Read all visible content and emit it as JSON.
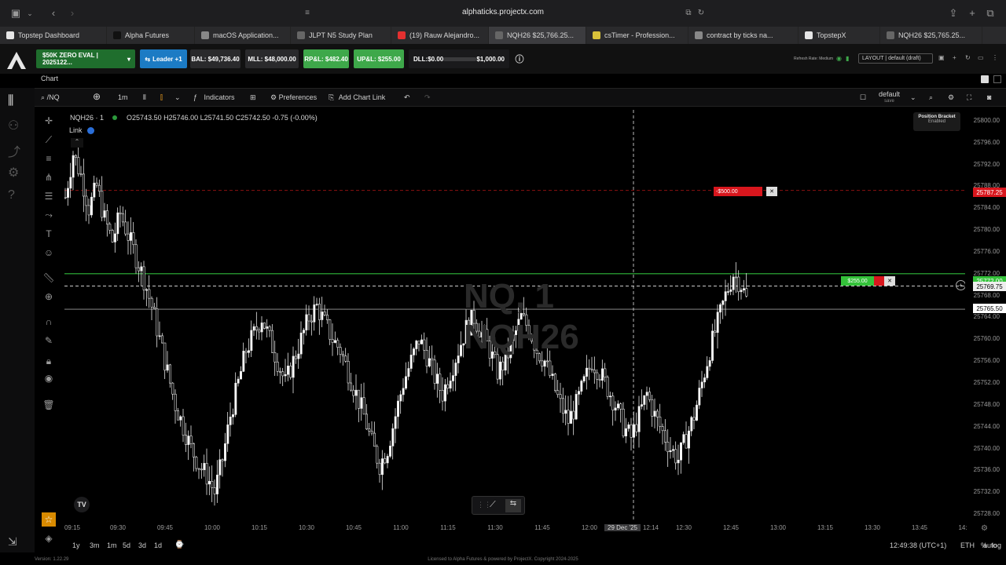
{
  "browser": {
    "url": "alphaticks.projectx.com",
    "tabs": [
      {
        "label": "Topstep Dashboard",
        "color": "#e6e6e6"
      },
      {
        "label": "Alpha Futures",
        "color": "#111111"
      },
      {
        "label": "macOS Application...",
        "color": "#888888"
      },
      {
        "label": "JLPT N5 Study Plan",
        "color": "#666666"
      },
      {
        "label": "(19) Rauw Alejandro...",
        "color": "#e33030"
      },
      {
        "label": "NQH26 $25,766.25...",
        "color": "#666666"
      },
      {
        "label": "csTimer - Profession...",
        "color": "#d9c23a"
      },
      {
        "label": "contract by ticks na...",
        "color": "#888888"
      },
      {
        "label": "TopstepX",
        "color": "#e6e6e6"
      },
      {
        "label": "NQH26 $25,765.25...",
        "color": "#666666"
      }
    ]
  },
  "account": {
    "account_label": "$50K ZERO EVAL | 2025122...",
    "leader_label": "Leader +1",
    "bal": "BAL: $49,736.40",
    "mll": "MLL: $48,000.00",
    "rpl": "RP&L: $482.40",
    "upl": "UP&L: $255.00",
    "dll": "DLL:$0.00",
    "dll_limit": "$1,000.00",
    "dll_progress": 0,
    "refresh": "Refresh Rate: Medium",
    "layout": "LAYOUT | default (draft)"
  },
  "chart_tab": "Chart",
  "toolbar": {
    "symbol": "/NQ",
    "interval": "1m",
    "indicators": "Indicators",
    "preferences": "Preferences",
    "add_chart_link": "Add Chart Link",
    "template": "default",
    "template_sub": "save"
  },
  "legend": {
    "title": "NQH26 · 1",
    "ohlc": "O25743.50 H25746.00 L25741.50 C25742.50 -0.75 (-0.00%)",
    "link": "Link"
  },
  "watermark": {
    "line1": "NQ, 1",
    "line2": "NQH26"
  },
  "position_bracket": {
    "title": "Position Bracket",
    "status": "Enabled"
  },
  "orders": {
    "stop_label": "-$500.00",
    "stop_price": "25787.25",
    "position_label": "$255.00",
    "position_price": "25769.75",
    "last_price": "25765.50",
    "green_line_price": "25772.00"
  },
  "chart_data": {
    "type": "candlestick",
    "symbol": "NQH26",
    "interval": "1",
    "y_ticks": [
      "25800.00",
      "25796.00",
      "25792.00",
      "25788.00",
      "25784.00",
      "25780.00",
      "25776.00",
      "25772.00",
      "25768.00",
      "25764.00",
      "25760.00",
      "25756.00",
      "25752.00",
      "25748.00",
      "25744.00",
      "25740.00",
      "25736.00",
      "25732.00",
      "25728.00"
    ],
    "x_ticks": [
      "09:15",
      "09:30",
      "09:45",
      "10:00",
      "10:15",
      "10:30",
      "10:45",
      "11:00",
      "11:15",
      "11:30",
      "11:45",
      "12:00",
      "29 Dec '25",
      "12:14",
      "12:30",
      "12:45",
      "13:00",
      "13:15",
      "13:30",
      "13:45",
      "14:"
    ],
    "ylim": [
      25727,
      25802
    ],
    "series": [
      {
        "values": [
          25786,
          25794,
          25790,
          25784,
          25788,
          25782,
          25778,
          25783,
          25779,
          25775,
          25771,
          25766,
          25760,
          25754,
          25748,
          25744,
          25740,
          25737,
          25735,
          25732,
          25738,
          25746,
          25752,
          25758,
          25761,
          25764,
          25760,
          25756,
          25752,
          25756,
          25760,
          25764,
          25766,
          25763,
          25760,
          25758,
          25754,
          25750,
          25746,
          25741,
          25737,
          25740,
          25746,
          25752,
          25756,
          25760,
          25757,
          25753,
          25750,
          25754,
          25758,
          25762,
          25764,
          25761,
          25758,
          25754,
          25756,
          25760,
          25764,
          25762,
          25758,
          25756,
          25752,
          25748,
          25745,
          25748,
          25752,
          25756,
          25754,
          25751,
          25748,
          25744,
          25742,
          25746,
          25750,
          25746,
          25743,
          25740,
          25738,
          25742,
          25746,
          25752,
          25758,
          25763,
          25768,
          25772,
          25770,
          25766
        ]
      }
    ]
  },
  "time_axis": {
    "ranges": [
      "1y",
      "3m",
      "1m",
      "5d",
      "3d",
      "1d"
    ],
    "clock": "12:49:38 (UTC+1)",
    "session": "ETH",
    "percent": "%",
    "log": "log",
    "auto": "auto"
  },
  "footer": {
    "version": "Version: 1.22.29",
    "license": "Licensed to Alpha Futures & powered by ProjectX. Copyright 2024-2025"
  }
}
